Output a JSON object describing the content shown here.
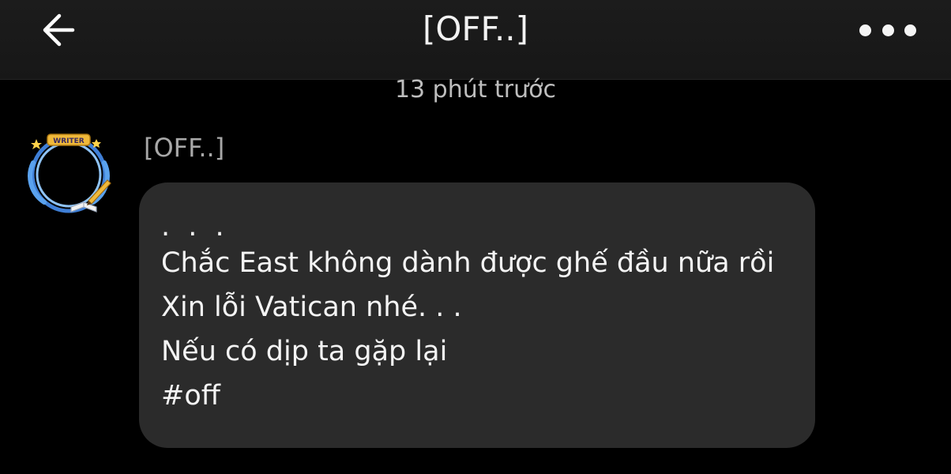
{
  "header": {
    "title": "[OFF..]",
    "back_icon": "arrow-left-icon",
    "more_icon": "more-horizontal-icon"
  },
  "conversation": {
    "timestamp": "13 phút trước",
    "messages": [
      {
        "sender": "[OFF..]",
        "avatar_frame_badge": "WRITER",
        "lines": [
          ". . .",
          "Chắc East không dành được ghế đầu nữa rồi",
          "Xin lỗi Vatican nhé. . .",
          "Nếu có dịp ta gặp lại",
          "#off"
        ]
      }
    ]
  },
  "colors": {
    "background": "#000000",
    "header_bg": "#1a1a1a",
    "bubble_bg": "#2b2b2b",
    "text_primary": "#f4f4f4",
    "text_secondary": "#bdbdbd",
    "avatar_frame_blue": "#4a8fe0",
    "avatar_frame_gold": "#f0b93a"
  }
}
